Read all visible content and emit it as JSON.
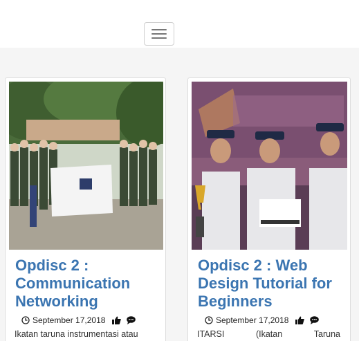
{
  "header": {
    "menu_icon": "hamburger-menu-icon"
  },
  "posts": [
    {
      "title": "Opdisc 2 : Communication Networking",
      "date": "September 17,2018",
      "excerpt": "Ikatan taruna instrumentasi atau",
      "image_alt": "group-photo-itarsi",
      "icons": [
        "clock-icon",
        "thumbs-up-icon",
        "comment-icon"
      ]
    },
    {
      "title": "Opdisc 2 : Web Design Tutorial for Beginners",
      "date": "September 17,2018",
      "excerpt_words": [
        "ITARSI",
        "(Ikatan",
        "Taruna"
      ],
      "image_alt": "contest-winners-photo",
      "icons": [
        "clock-icon",
        "thumbs-up-icon",
        "comment-icon"
      ]
    }
  ],
  "colors": {
    "title": "#3b75b1",
    "background": "#f5f5f5",
    "card_border": "#dddddd"
  }
}
